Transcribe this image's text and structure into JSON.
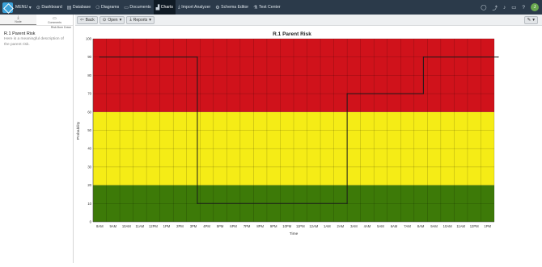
{
  "nav": {
    "menu_label": "MENU",
    "items": [
      {
        "label": "Dashboard",
        "icon": "dashboard-icon",
        "glyph": "⊙"
      },
      {
        "label": "Database",
        "icon": "database-icon",
        "glyph": "▤"
      },
      {
        "label": "Diagrams",
        "icon": "diagram-icon",
        "glyph": "⚆"
      },
      {
        "label": "Documents",
        "icon": "document-icon",
        "glyph": "▭"
      },
      {
        "label": "Charts",
        "icon": "chart-icon",
        "glyph": "▟"
      },
      {
        "label": "Import Analyzer",
        "icon": "import-icon",
        "glyph": "⤓"
      },
      {
        "label": "Schema Editor",
        "icon": "schema-icon",
        "glyph": "⚙"
      },
      {
        "label": "Test Center",
        "icon": "flask-icon",
        "glyph": "⚗"
      }
    ],
    "active": "Charts",
    "avatar_initial": "J"
  },
  "sidebar": {
    "tabs": [
      {
        "label": "Node",
        "icon": "download-icon",
        "glyph": "⤓"
      },
      {
        "label": "Comments",
        "icon": "comment-icon",
        "glyph": "💬"
      }
    ],
    "subtitle": "Risk Burn Down",
    "title": "R.1 Parent Risk",
    "description": "Here is a meaningful description of the parent risk."
  },
  "toolbar": {
    "back_label": "Back",
    "open_label": "Open",
    "reports_label": "Reports"
  },
  "colors": {
    "red": "#d0121b",
    "yellow": "#f5ec16",
    "green": "#3d7a08",
    "line": "#1a1a1a"
  },
  "chart_data": {
    "type": "line",
    "title": "R.1 Parent Risk",
    "xlabel": "Time",
    "ylabel": "Probability",
    "ylim": [
      0,
      100
    ],
    "yticks": [
      0,
      10,
      20,
      30,
      40,
      50,
      60,
      70,
      80,
      90,
      100
    ],
    "categories": [
      "8AM",
      "9AM",
      "10AM",
      "11AM",
      "12PM",
      "1PM",
      "2PM",
      "3PM",
      "4PM",
      "5PM",
      "6PM",
      "7PM",
      "8PM",
      "9PM",
      "10PM",
      "11PM",
      "12AM",
      "1AM",
      "2AM",
      "3AM",
      "4AM",
      "5AM",
      "6AM",
      "7AM",
      "8AM",
      "9AM",
      "10AM",
      "11AM",
      "12PM",
      "1PM"
    ],
    "bands": [
      {
        "from": 0,
        "to": 20,
        "color": "green"
      },
      {
        "from": 20,
        "to": 60,
        "color": "yellow"
      },
      {
        "from": 60,
        "to": 100,
        "color": "red"
      }
    ],
    "grid": true,
    "series": [
      {
        "x": [
          0,
          7.3,
          7.3,
          18.5,
          18.5,
          24.2,
          24.2,
          29.8
        ],
        "y": [
          90,
          90,
          10,
          10,
          70,
          70,
          90,
          90
        ]
      }
    ]
  }
}
